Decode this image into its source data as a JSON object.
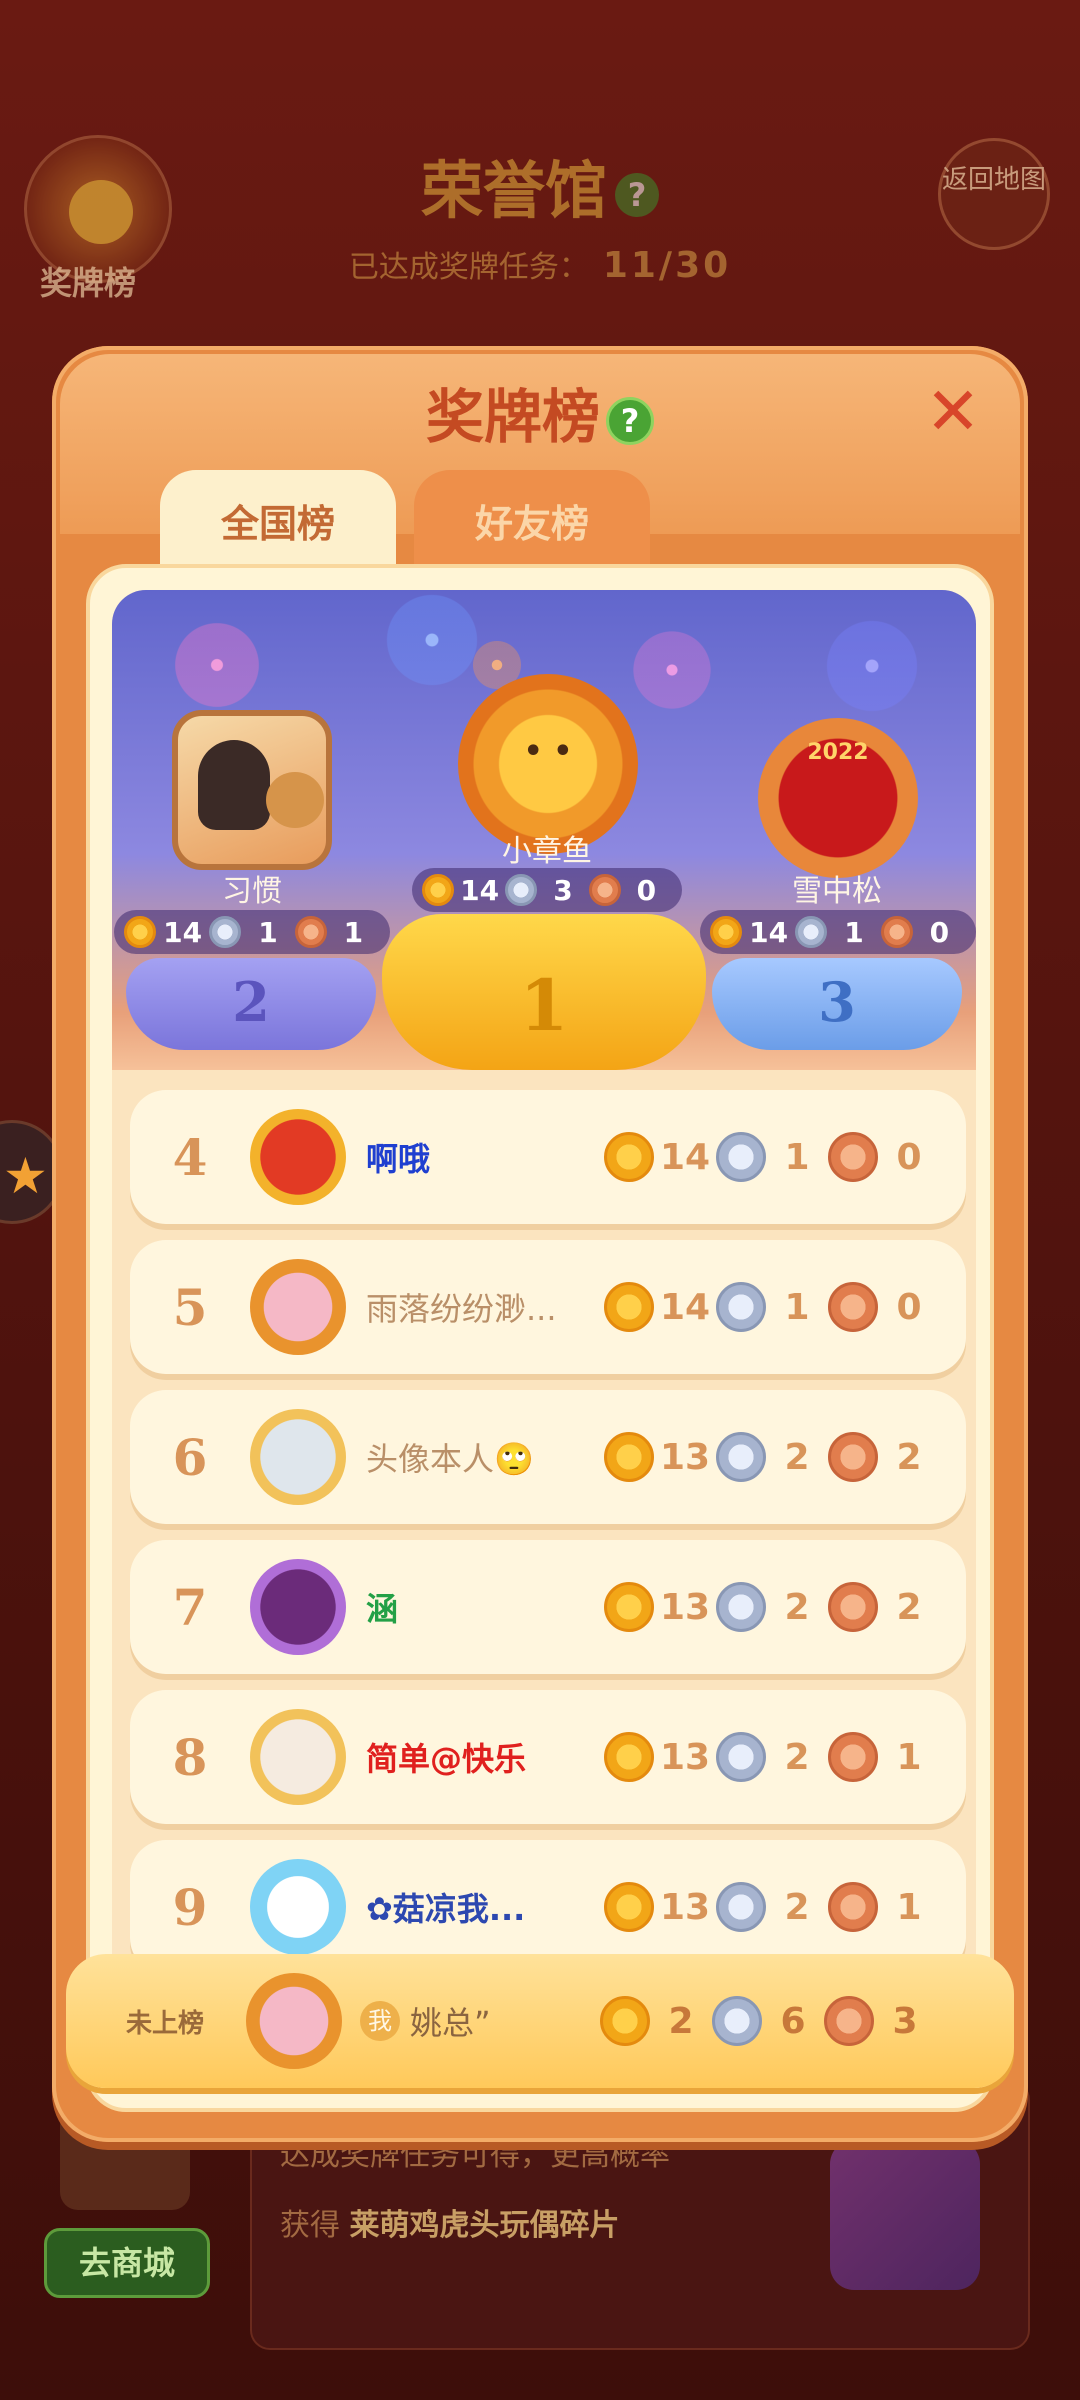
{
  "background": {
    "title": "荣誉馆",
    "help_icon": "?",
    "progress_label": "已达成奖牌任务：",
    "progress_value": "11/30",
    "medal_button_label": "奖牌榜",
    "back_button_label": "返回地图",
    "bottom_text_1": "达成奖牌任务可得",
    "bottom_text_1b": "，更高概率",
    "bottom_text_2": "获得",
    "bottom_text_2_highlight": "莱萌鸡虎头玩偶碎片",
    "shop_button_label": "去商城"
  },
  "modal": {
    "title": "奖牌榜",
    "help_icon": "?",
    "close_icon": "✕",
    "tabs": [
      {
        "label": "全国榜",
        "active": true
      },
      {
        "label": "好友榜",
        "active": false
      }
    ]
  },
  "podium": [
    {
      "rank": "2",
      "name": "习惯",
      "gold": "14",
      "silver": "1",
      "bronze": "1"
    },
    {
      "rank": "1",
      "name": "小章鱼",
      "gold": "14",
      "silver": "3",
      "bronze": "0"
    },
    {
      "rank": "3",
      "name": "雪中松",
      "gold": "14",
      "silver": "1",
      "bronze": "0"
    }
  ],
  "rows": [
    {
      "rank": "4",
      "name": "啊哦",
      "gold": "14",
      "silver": "1",
      "bronze": "0"
    },
    {
      "rank": "5",
      "name": "雨落纷纷渺...",
      "gold": "14",
      "silver": "1",
      "bronze": "0"
    },
    {
      "rank": "6",
      "name": "头像本人🙄",
      "gold": "13",
      "silver": "2",
      "bronze": "2"
    },
    {
      "rank": "7",
      "name": "涵",
      "gold": "13",
      "silver": "2",
      "bronze": "2"
    },
    {
      "rank": "8",
      "name": "简单@快乐",
      "gold": "13",
      "silver": "2",
      "bronze": "1"
    },
    {
      "rank": "9",
      "name": "✿菇凉我...",
      "gold": "13",
      "silver": "2",
      "bronze": "1"
    }
  ],
  "me": {
    "rank_label": "未上榜",
    "me_badge": "我",
    "name": "姚总”",
    "gold": "2",
    "silver": "6",
    "bronze": "3"
  },
  "colors": {
    "modal": "#e68942",
    "board": "#fff5d6",
    "gold": "#f2a617",
    "silver": "#a7b4cf",
    "bronze": "#e17d4d"
  }
}
